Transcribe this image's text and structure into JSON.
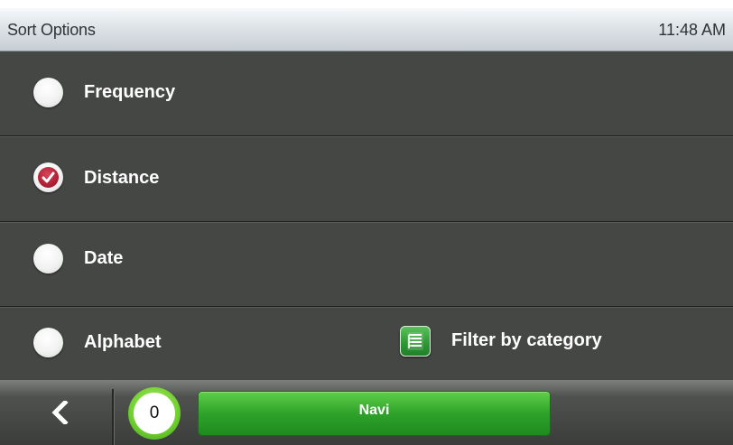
{
  "header": {
    "title": "Sort Options",
    "time": "11:48 AM"
  },
  "options": [
    {
      "label": "Frequency",
      "selected": false
    },
    {
      "label": "Distance",
      "selected": true
    },
    {
      "label": "Date",
      "selected": false
    },
    {
      "label": "Alphabet",
      "selected": false
    }
  ],
  "filter": {
    "label": "Filter by category",
    "icon": "category-list-icon"
  },
  "bottom_bar": {
    "back_icon": "chevron-left-icon",
    "counter": "0",
    "navi_label": "Navi"
  },
  "colors": {
    "list_bg": "#454745",
    "selected_radio": "#b01f34",
    "navi_button": "#2ea32a",
    "filter_icon": "#2f9a35"
  }
}
